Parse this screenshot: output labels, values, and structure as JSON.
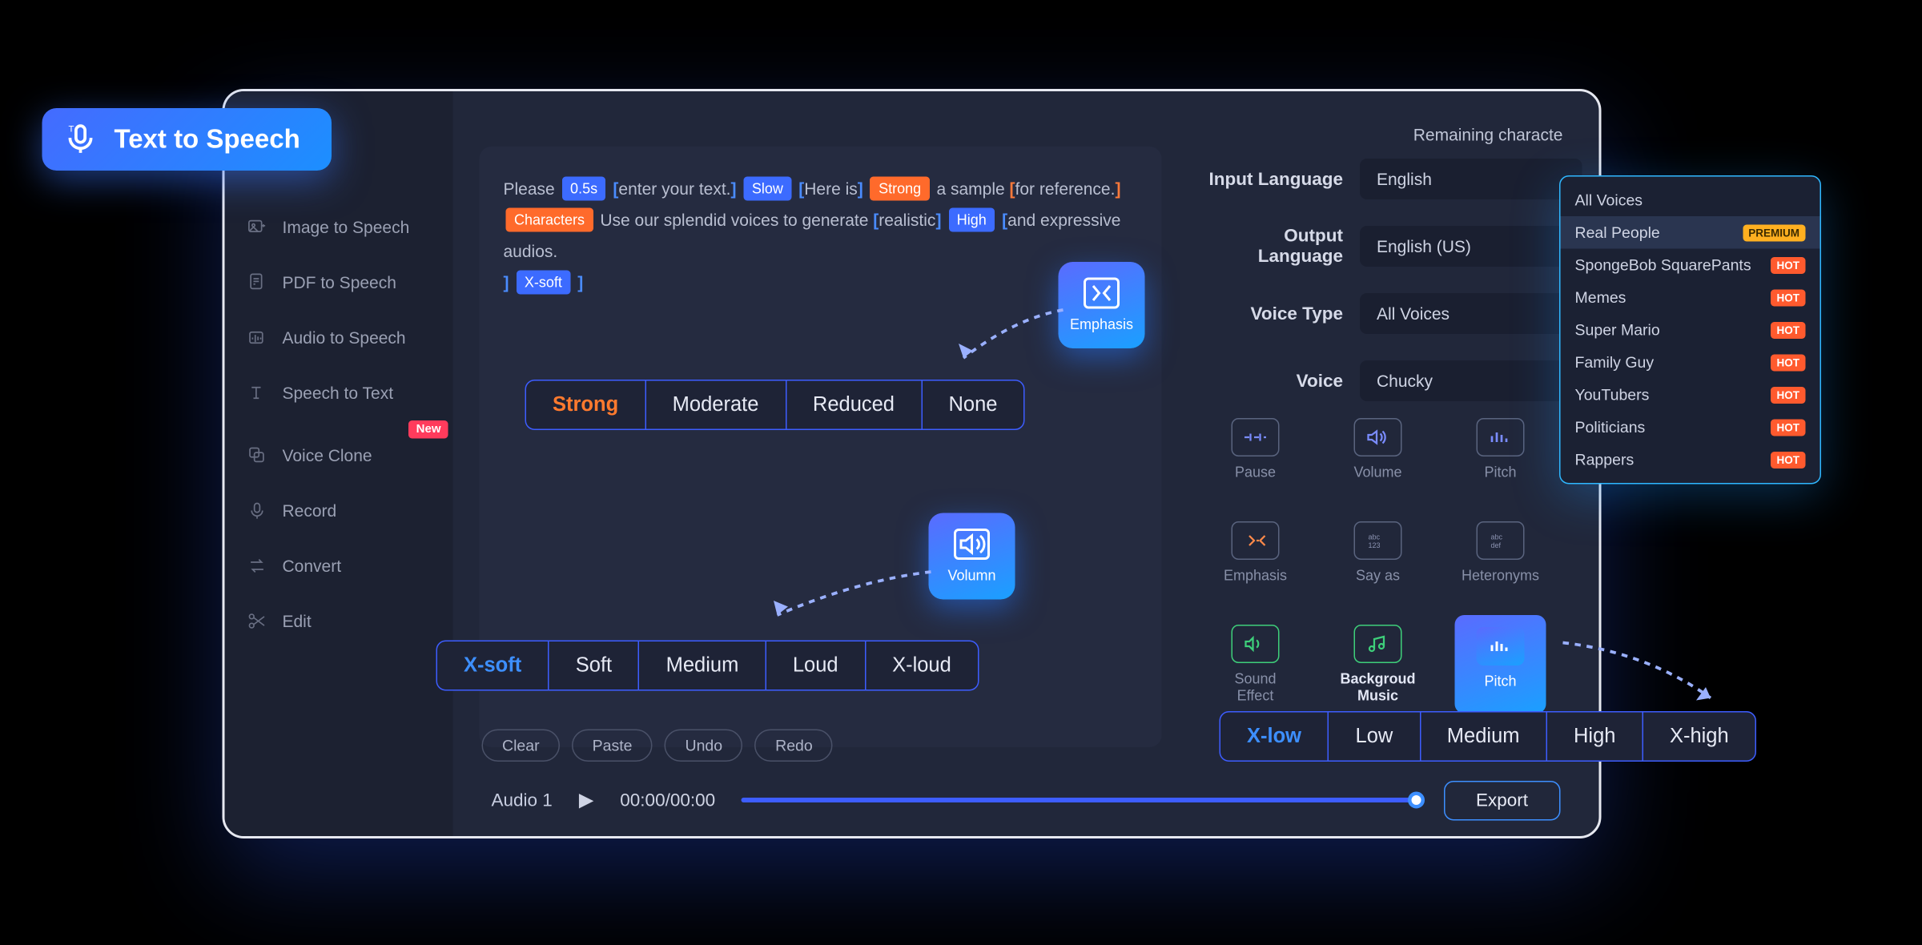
{
  "tts_badge": "Text  to Speech",
  "sidebar": {
    "items": [
      {
        "label": "Image to Speech"
      },
      {
        "label": "PDF to Speech"
      },
      {
        "label": "Audio to Speech"
      },
      {
        "label": "Speech to Text"
      },
      {
        "label": "Voice Clone",
        "new": "New"
      },
      {
        "label": "Record"
      },
      {
        "label": "Convert"
      },
      {
        "label": "Edit"
      }
    ]
  },
  "remaining": "Remaining characte",
  "editor": {
    "t1": "Please",
    "tag_05s": "0.5s",
    "t2": "enter your text.",
    "tag_slow": "Slow",
    "t3": "Here is",
    "tag_strong": "Strong",
    "t4": "a sample",
    "t5": "for reference.",
    "tag_chars": "Characters",
    "t6": "Use our splendid voices to generate",
    "t7": "realistic",
    "tag_high": "High",
    "t8": "and expressive audios.",
    "tag_xsoft": "X-soft"
  },
  "emphasis": {
    "label": "Emphasis",
    "opts": [
      "Strong",
      "Moderate",
      "Reduced",
      "None"
    ]
  },
  "volume": {
    "label": "Volumn",
    "opts": [
      "X-soft",
      "Soft",
      "Medium",
      "Loud",
      "X-loud"
    ]
  },
  "pitch": {
    "label": "Pitch",
    "opts": [
      "X-low",
      "Low",
      "Medium",
      "High",
      "X-high"
    ]
  },
  "settings": {
    "input_lang_label": "Input Language",
    "input_lang": "English",
    "output_lang_label": "Output Language",
    "output_lang": "English (US)",
    "voice_type_label": "Voice Type",
    "voice_type": "All Voices",
    "voice_label": "Voice",
    "voice": "Chucky"
  },
  "tools": {
    "pause": "Pause",
    "volume": "Volume",
    "pitch": "Pitch",
    "emphasis": "Emphasis",
    "sayas": "Say as",
    "hetero": "Heteronyms",
    "sound": "Sound\nEffect",
    "bg": "Backgroud\nMusic",
    "pitch2": "Pitch"
  },
  "editor_buttons": {
    "clear": "Clear",
    "paste": "Paste",
    "undo": "Undo",
    "redo": "Redo"
  },
  "audio": {
    "name": "Audio 1",
    "time": "00:00/00:00",
    "export": "Export"
  },
  "voice_dropdown": {
    "items": [
      {
        "label": "All Voices"
      },
      {
        "label": "Real People",
        "badge": "PREMIUM",
        "badge_cls": "prem",
        "selected": true
      },
      {
        "label": "SpongeBob SquarePants",
        "badge": "HOT",
        "badge_cls": "hot"
      },
      {
        "label": "Memes",
        "badge": "HOT",
        "badge_cls": "hot"
      },
      {
        "label": "Super Mario",
        "badge": "HOT",
        "badge_cls": "hot"
      },
      {
        "label": "Family Guy",
        "badge": "HOT",
        "badge_cls": "hot"
      },
      {
        "label": "YouTubers",
        "badge": "HOT",
        "badge_cls": "hot"
      },
      {
        "label": "Politicians",
        "badge": "HOT",
        "badge_cls": "hot"
      },
      {
        "label": "Rappers",
        "badge": "HOT",
        "badge_cls": "hot"
      }
    ]
  }
}
